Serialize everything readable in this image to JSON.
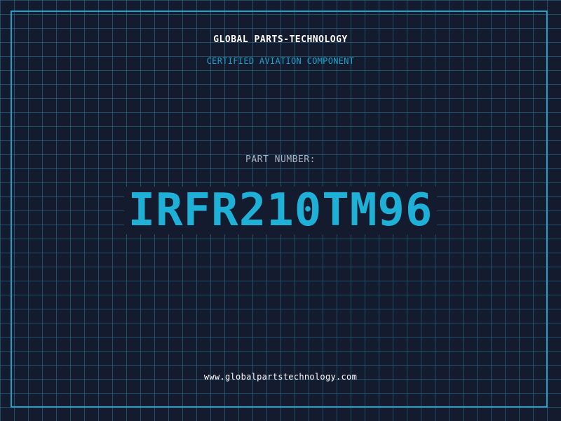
{
  "header": {
    "company": "GLOBAL PARTS-TECHNOLOGY",
    "subtitle": "CERTIFIED AVIATION COMPONENT"
  },
  "part": {
    "label": "PART NUMBER:",
    "number": "IRFR210TM96"
  },
  "footer": {
    "url": "www.globalpartstechnology.com"
  },
  "colors": {
    "background": "#141b2e",
    "grid": "#287896",
    "accent": "#1aa3cc",
    "part_number": "#1fb0d8",
    "text_primary": "#ffffff",
    "text_muted": "#aab4c4"
  }
}
